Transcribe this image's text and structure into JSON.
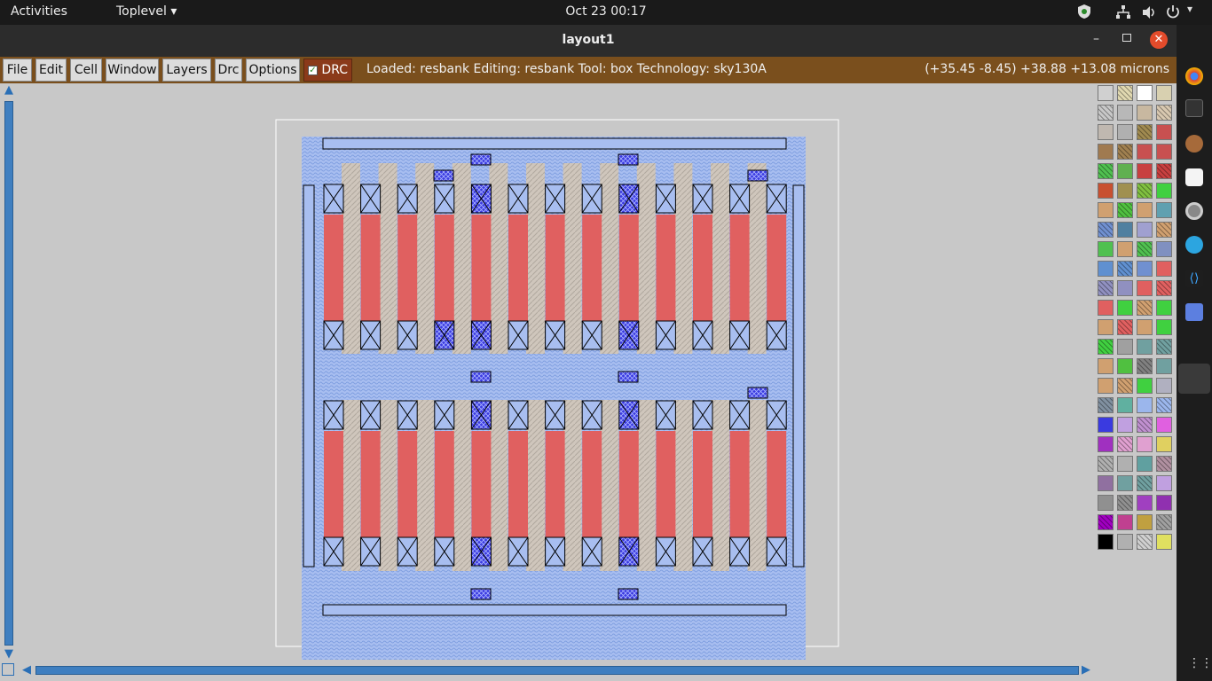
{
  "system": {
    "activities": "Activities",
    "app_menu": "Toplevel ▾",
    "datetime": "Oct 23  00:17"
  },
  "window": {
    "title": "layout1"
  },
  "menu": {
    "items": [
      "File",
      "Edit",
      "Cell",
      "Window",
      "Layers",
      "Drc",
      "Options"
    ],
    "drc_toggle": "DRC",
    "drc_checked": true
  },
  "status": {
    "text": "Loaded: resbank Editing: resbank Tool: box  Technology: sky130A",
    "coords": "(+35.45 -8.45) +38.88 +13.08 microns"
  },
  "colors": {
    "menu_bg": "#7a4f1d",
    "canvas_bg": "#c8c8c8",
    "poly": "#e06060",
    "met_blue": "#9bb6ec",
    "via": "#3a3ae0",
    "diff": "#c9b9a9"
  },
  "icons": {
    "shield": "shield-icon",
    "network": "network-icon",
    "volume": "volume-icon",
    "power": "power-icon",
    "minimize": "minimize-icon",
    "maximize": "maximize-icon",
    "close": "close-icon",
    "grid": "app-grid-icon"
  },
  "palette_colors": [
    "#d0d0d0",
    "#e0d8b0",
    "#ffffff",
    "#d8d0b0",
    "#c8c8c8",
    "#b8b8b8",
    "#c8b8a0",
    "#d8c8b0",
    "#c0b8b0",
    "#b0b0b0",
    "#a08a50",
    "#c85050",
    "#a07a50",
    "#a08050",
    "#c85050",
    "#c85050",
    "#50c050",
    "#60b050",
    "#c84040",
    "#c84040",
    "#c85030",
    "#a09050",
    "#80c040",
    "#40d040",
    "#d0a070",
    "#50c040",
    "#d0a070",
    "#60a0b0",
    "#7090d0",
    "#5080a0",
    "#a0a0d0",
    "#d0a070",
    "#50c050",
    "#d0a070",
    "#50c050",
    "#8090c0",
    "#6090d0",
    "#6090d0",
    "#7090d0",
    "#e06060",
    "#9090c0",
    "#9090c0",
    "#e06060",
    "#e06060",
    "#e06060",
    "#40d040",
    "#d0a070",
    "#40d040",
    "#d0a070",
    "#e06060",
    "#d0a070",
    "#40d040",
    "#40d040",
    "#a0a0a0",
    "#70a0a0",
    "#70a0a0",
    "#d0a070",
    "#50c040",
    "#808080",
    "#70a0a0",
    "#d0a070",
    "#d0a070",
    "#40d040",
    "#b0b0c0",
    "#8090a0",
    "#60b0a0",
    "#9bb6ec",
    "#9bb6ec",
    "#3a3ae0",
    "#c0a0e0",
    "#c090d0",
    "#e060e0",
    "#a030c0",
    "#e0a0d0",
    "#e0a0d0",
    "#e0d060",
    "#b0b0b0",
    "#b0b0b0",
    "#60a0a0",
    "#b090a0",
    "#9070a0",
    "#70a0a0",
    "#70a0a0",
    "#c0a0e0",
    "#909090",
    "#909090",
    "#a040c0",
    "#9030b0",
    "#a000c0",
    "#c04090",
    "#c0a040",
    "#a0a0a0",
    "#000000",
    "#b0b0b0",
    "#d0d0d0",
    "#e0e060"
  ]
}
